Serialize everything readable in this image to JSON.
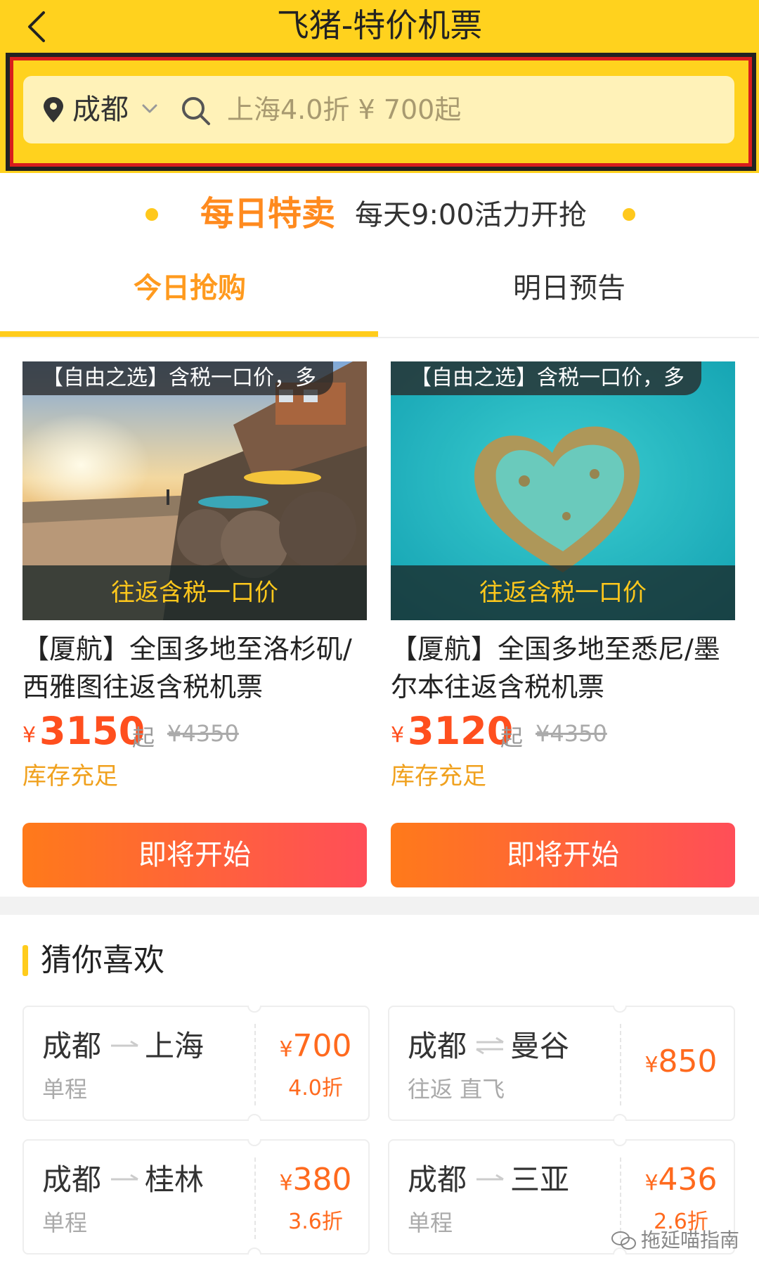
{
  "header": {
    "title": "飞猪-特价机票",
    "search": {
      "city": "成都",
      "placeholder": "上海4.0折 ¥ 700起"
    }
  },
  "daily_special": {
    "title": "每日特卖",
    "subtitle": "每天9:00活力开抢"
  },
  "tabs": [
    {
      "label": "今日抢购",
      "active": true
    },
    {
      "label": "明日预告",
      "active": false
    }
  ],
  "products": [
    {
      "tag": "【自由之选】含税一口价，多",
      "banner": "往返含税一口价",
      "title": "【厦航】全国多地至洛杉矶/西雅图往返含税机票",
      "currency": "¥",
      "price": "3150",
      "price_suffix": "起",
      "original_price": "¥4350",
      "stock": "库存充足",
      "button": "即将开始",
      "image": "beach-sunset"
    },
    {
      "tag": "【自由之选】含税一口价，多",
      "banner": "往返含税一口价",
      "title": "【厦航】全国多地至悉尼/墨尔本往返含税机票",
      "currency": "¥",
      "price": "3120",
      "price_suffix": "起",
      "original_price": "¥4350",
      "stock": "库存充足",
      "button": "即将开始",
      "image": "heart-reef"
    }
  ],
  "guess": {
    "title": "猜你喜欢",
    "routes": [
      {
        "from": "成都",
        "to": "上海",
        "direction": "one-way",
        "meta": "单程",
        "currency": "¥",
        "price": "700",
        "discount": "4.0折"
      },
      {
        "from": "成都",
        "to": "曼谷",
        "direction": "round-trip",
        "meta": "往返  直飞",
        "currency": "¥",
        "price": "850",
        "discount": ""
      },
      {
        "from": "成都",
        "to": "桂林",
        "direction": "one-way",
        "meta": "单程",
        "currency": "¥",
        "price": "380",
        "discount": "3.6折"
      },
      {
        "from": "成都",
        "to": "三亚",
        "direction": "one-way",
        "meta": "单程",
        "currency": "¥",
        "price": "436",
        "discount": "2.6折"
      }
    ]
  },
  "watermark": "拖延喵指南",
  "colors": {
    "header_bg": "#ffd21e",
    "accent_orange": "#ff9a1e",
    "price_red": "#ff4f1e",
    "highlight_border": "#d81d1d"
  }
}
